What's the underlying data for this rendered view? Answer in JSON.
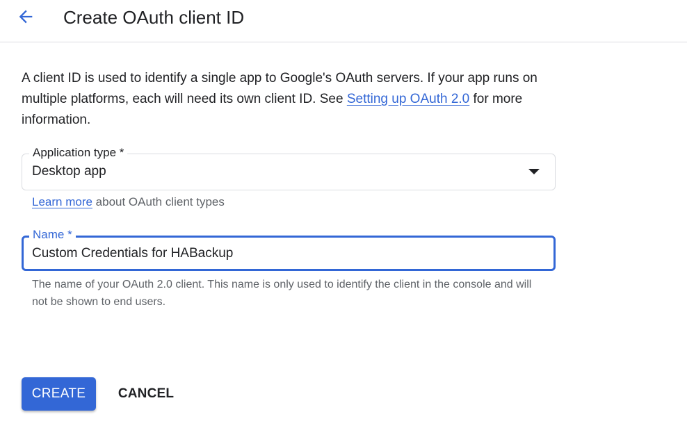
{
  "header": {
    "back_icon": "arrow-back-icon",
    "title": "Create OAuth client ID"
  },
  "intro": {
    "text_before_link": "A client ID is used to identify a single app to Google's OAuth servers. If your app runs on multiple platforms, each will need its own client ID. See ",
    "link_text": "Setting up OAuth 2.0",
    "text_after_link": " for more information."
  },
  "application_type": {
    "label": "Application type *",
    "selected_value": "Desktop app",
    "dropdown_icon": "dropdown-arrow-icon",
    "helper_link_text": "Learn more",
    "helper_text": " about OAuth client types"
  },
  "name_field": {
    "label": "Name *",
    "value": "Custom Credentials for HABackup",
    "helper_text": "The name of your OAuth 2.0 client. This name is only used to identify the client in the console and will not be shown to end users."
  },
  "actions": {
    "create_label": "CREATE",
    "cancel_label": "CANCEL"
  },
  "colors": {
    "accent": "#3367d6",
    "text": "#202124",
    "secondary_text": "#5f6368",
    "border": "#dadce0"
  }
}
